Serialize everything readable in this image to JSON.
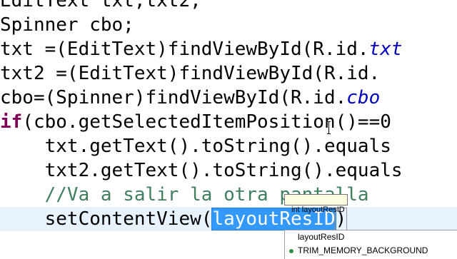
{
  "editor": {
    "lines": [
      {
        "indent": "",
        "parts": [
          {
            "t": "EditText txt,txt2;",
            "c": "plain"
          }
        ]
      },
      {
        "indent": "",
        "parts": [
          {
            "t": "Spinner cbo;",
            "c": "plain"
          }
        ]
      },
      {
        "indent": "",
        "parts": [
          {
            "t": "txt =(EditText)findViewById(R.id.",
            "c": "plain"
          },
          {
            "t": "txt",
            "c": "fld"
          }
        ]
      },
      {
        "indent": "",
        "parts": [
          {
            "t": "txt2 =(EditText)findViewById(R.id.",
            "c": "plain"
          }
        ]
      },
      {
        "indent": "",
        "parts": [
          {
            "t": "cbo=(Spinner)findViewById(R.id.",
            "c": "plain"
          },
          {
            "t": "cbo",
            "c": "fld"
          }
        ]
      },
      {
        "indent": "",
        "parts": [
          {
            "t": "if",
            "c": "kw"
          },
          {
            "t": "(cbo.getSelectedItemPosition()==0",
            "c": "plain"
          }
        ]
      },
      {
        "indent": "    ",
        "parts": [
          {
            "t": "txt.getText().toString().equals",
            "c": "plain"
          }
        ]
      },
      {
        "indent": "    ",
        "parts": [
          {
            "t": "txt2.getText().toString().equals",
            "c": "plain"
          }
        ]
      },
      {
        "indent": "    ",
        "parts": [
          {
            "t": "//Va a salir la otra pantalla",
            "c": "cmt"
          }
        ]
      },
      {
        "indent": "    ",
        "parts": [
          {
            "t": "setContentView(",
            "c": "plain"
          },
          {
            "t": "layoutResID",
            "c": "sel-param"
          },
          {
            "t": ")",
            "c": "caret-bracket"
          }
        ],
        "current": true
      }
    ]
  },
  "tooltip": {
    "text": "int layoutResID"
  },
  "autocomplete": {
    "items": [
      {
        "label": "layoutResID",
        "icon": "local"
      },
      {
        "label": "TRIM_MEMORY_BACKGROUND",
        "icon": "const"
      }
    ]
  }
}
